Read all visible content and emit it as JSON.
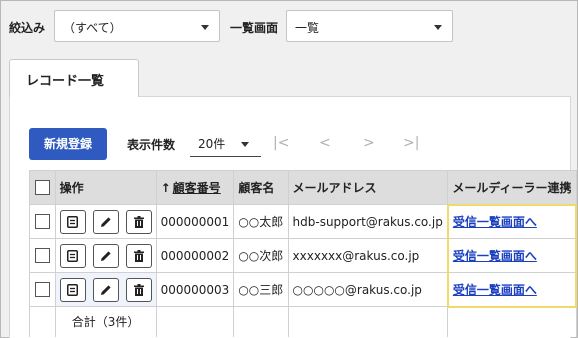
{
  "filters": {
    "narrow_label": "絞込み",
    "narrow_value": "（すべて）",
    "screen_label": "一覧画面",
    "screen_value": "一覧"
  },
  "tabs": [
    {
      "label": "レコード一覧"
    }
  ],
  "toolbar": {
    "new_button": "新規登録",
    "per_page_label": "表示件数",
    "per_page_value": "20件",
    "pager": {
      "first": "|<",
      "prev": "<",
      "next": ">",
      "last": ">|"
    }
  },
  "table": {
    "headers": {
      "ops": "操作",
      "sort_icon": "↑",
      "customer_no": "顧客番号",
      "customer_name": "顧客名",
      "email": "メールアドレス",
      "mail_dealer": "メールディーラー連携"
    },
    "rows": [
      {
        "customer_no": "000000001",
        "customer_name": "○○太郎",
        "email": "hdb-support@rakus.co.jp",
        "link": "受信一覧画面へ"
      },
      {
        "customer_no": "000000002",
        "customer_name": "○○次郎",
        "email": "xxxxxxx@rakus.co.jp",
        "link": "受信一覧画面へ"
      },
      {
        "customer_no": "000000003",
        "customer_name": "○○三郎",
        "email": "○○○○○@rakus.co.jp",
        "link": "受信一覧画面へ"
      }
    ],
    "total": "合計（3件）"
  },
  "icons": {
    "detail": "document-icon",
    "edit": "pencil-icon",
    "delete": "trash-icon"
  },
  "colors": {
    "primary": "#2f5bc0",
    "link": "#1a3fbf",
    "highlight": "#f2d96b",
    "header_bg": "#dddddd"
  }
}
